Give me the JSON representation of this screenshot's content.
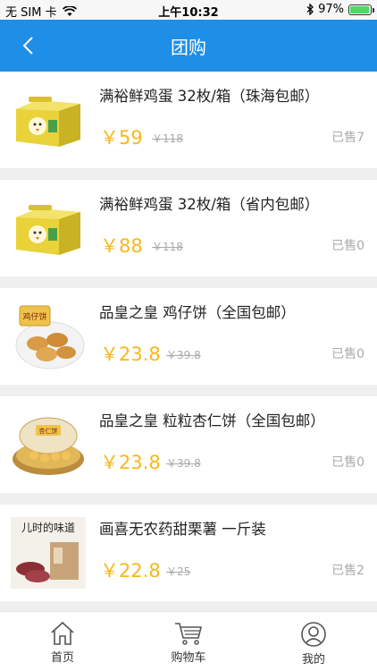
{
  "status_bar": {
    "carrier": "无 SIM 卡",
    "time": "上午10:32",
    "battery": "97%"
  },
  "nav": {
    "title": "团购"
  },
  "products": [
    {
      "title": "满裕鲜鸡蛋 32枚/箱（珠海包邮）",
      "price": "￥59",
      "original_price": "￥118",
      "sold": "已售7",
      "image": "egg-box"
    },
    {
      "title": "满裕鲜鸡蛋 32枚/箱（省内包邮）",
      "price": "￥88",
      "original_price": "￥118",
      "sold": "已售0",
      "image": "egg-box"
    },
    {
      "title": "品皇之皇 鸡仔饼（全国包邮）",
      "price": "￥23.8",
      "original_price": "￥39.8",
      "sold": "已售0",
      "image": "cookie-plate"
    },
    {
      "title": "品皇之皇 粒粒杏仁饼（全国包邮）",
      "price": "￥23.8",
      "original_price": "￥39.8",
      "sold": "已售0",
      "image": "almond-cookies"
    },
    {
      "title": "画喜无农药甜栗薯 一斤装",
      "price": "￥22.8",
      "original_price": "￥25",
      "sold": "已售2",
      "image": "sweet-potato"
    }
  ],
  "product_image_text": {
    "cookie_label": "鸡仔饼",
    "almond_label": "杏仁饼",
    "potato_label": "儿时的味道"
  },
  "tabs": [
    {
      "label": "首页"
    },
    {
      "label": "购物车"
    },
    {
      "label": "我的"
    }
  ],
  "colors": {
    "nav": "#1f8ee6",
    "price": "#f6b81a",
    "muted": "#aaaaaa"
  }
}
